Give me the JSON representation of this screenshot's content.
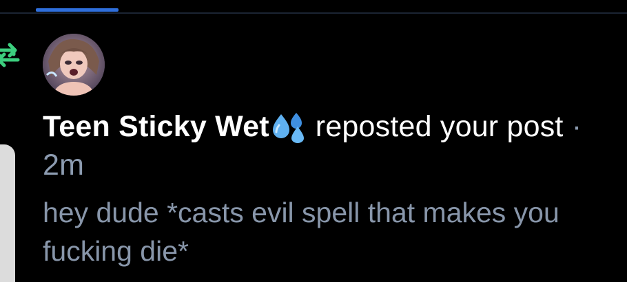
{
  "notification": {
    "author_name": "Teen Sticky Wet",
    "author_emoji": "sweat-droplets-emoji",
    "action_text": "reposted your",
    "object_text": "post",
    "separator": "·",
    "time_ago": "2m",
    "post_preview": "hey dude *casts evil spell that makes you fucking die*"
  },
  "icons": {
    "repost": "repost-icon",
    "avatar": "avatar"
  },
  "colors": {
    "background": "#000000",
    "tab_accent": "#2f6fdc",
    "repost_green": "#3ccf7e",
    "headline_text": "#ffffff",
    "secondary_text": "#8896aa"
  }
}
